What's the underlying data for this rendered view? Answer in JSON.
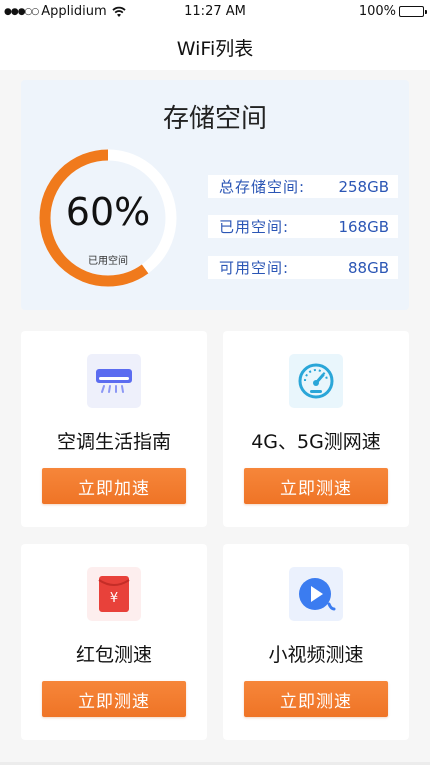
{
  "status_bar": {
    "carrier": "Applidium",
    "time": "11:27 AM",
    "battery": "100%"
  },
  "nav": {
    "title": "WiFi列表"
  },
  "storage": {
    "title": "存储空间",
    "percent_text": "60%",
    "percent_value": 60,
    "percent_label": "已用空间",
    "stats": [
      {
        "label": "总存储空间:",
        "value": "258GB"
      },
      {
        "label": "已用空间:",
        "value": "168GB"
      },
      {
        "label": "可用空间:",
        "value": "88GB"
      }
    ]
  },
  "cards": [
    {
      "title": "空调生活指南",
      "button": "立即加速",
      "icon": "air-conditioner-icon"
    },
    {
      "title": "4G、5G测网速",
      "button": "立即测速",
      "icon": "speedometer-icon"
    },
    {
      "title": "红包测速",
      "button": "立即测速",
      "icon": "red-envelope-icon"
    },
    {
      "title": "小视频测速",
      "button": "立即测速",
      "icon": "video-play-icon"
    }
  ],
  "colors": {
    "accent": "#f07a2c",
    "stat_text": "#2b56b5",
    "storage_bg": "#eef4fb"
  }
}
